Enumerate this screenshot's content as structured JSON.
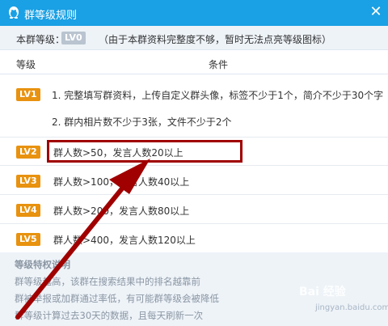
{
  "window": {
    "title": "群等级规则",
    "close_glyph": "✕"
  },
  "current": {
    "label": "本群等级：",
    "badge": "LV0",
    "note": "（由于本群资料完整度不够，暂时无法点亮等级图标）"
  },
  "table": {
    "col_level": "等级",
    "col_condition": "条件",
    "rows": [
      {
        "badge": "LV1",
        "lines": [
          "1. 完整填写群资料，上传自定义群头像，标签不少于1个，简介不少于30个字",
          "2. 群内相片数不少于3张，文件不少于2个"
        ]
      },
      {
        "badge": "LV2",
        "lines": [
          "群人数>50，发言人数20以上"
        ]
      },
      {
        "badge": "LV3",
        "lines": [
          "群人数>100，发言人数40以上"
        ]
      },
      {
        "badge": "LV4",
        "lines": [
          "群人数>200，发言人数80以上"
        ]
      },
      {
        "badge": "LV5",
        "lines": [
          "群人数>400，发言人数120以上"
        ]
      }
    ]
  },
  "footer": {
    "title": "等级特权说明",
    "lines": [
      "群等级越高，该群在搜索结果中的排名越靠前",
      "群被举报或加群通过率低，有可能群等级会被降低",
      "群等级计算过去30天的数据，且每天刷新一次"
    ]
  },
  "watermark": {
    "text": "Bai 经验",
    "sub": "jingyan.baidu.com"
  },
  "colors": {
    "titlebar": "#1aa0e4",
    "badge": "#e8920f",
    "highlight": "#a00000"
  },
  "icons": {
    "app": "qq-penguin-icon",
    "close": "close-icon"
  }
}
